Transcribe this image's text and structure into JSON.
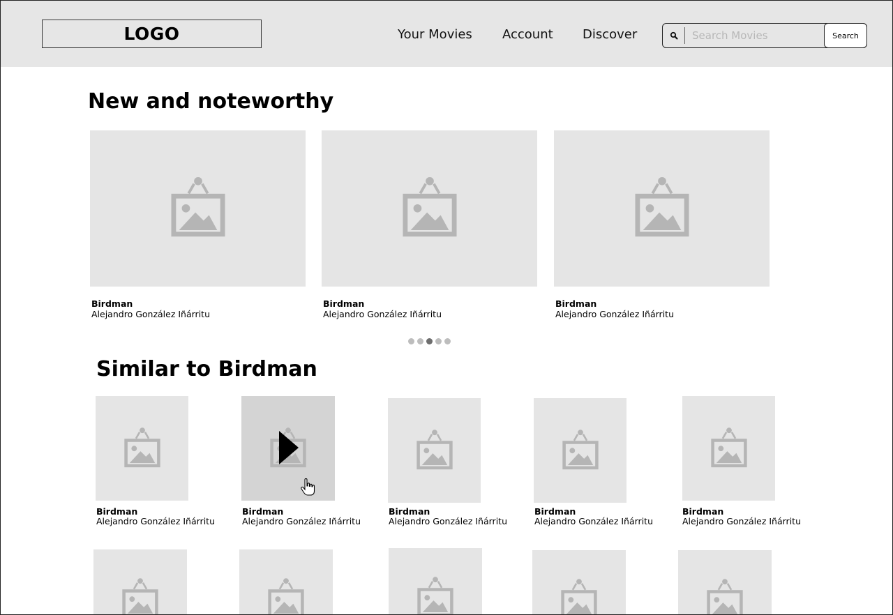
{
  "header": {
    "logo": "LOGO",
    "nav": [
      "Your Movies",
      "Account",
      "Discover"
    ],
    "search": {
      "placeholder": "Search Movies",
      "button": "Search",
      "icon": "search-icon"
    }
  },
  "featured": {
    "title": "New and noteworthy",
    "items": [
      {
        "title": "Birdman",
        "director": "Alejandro González Iñárritu"
      },
      {
        "title": "Birdman",
        "director": "Alejandro González Iñárritu"
      },
      {
        "title": "Birdman",
        "director": "Alejandro González Iñárritu"
      }
    ],
    "pagination": {
      "count": 5,
      "active": 3
    }
  },
  "similar": {
    "title": "Similar to Birdman",
    "items": [
      {
        "title": "Birdman",
        "director": "Alejandro González Iñárritu"
      },
      {
        "title": "Birdman",
        "director": "Alejandro González Iñárritu"
      },
      {
        "title": "Birdman",
        "director": "Alejandro González Iñárritu"
      },
      {
        "title": "Birdman",
        "director": "Alejandro González Iñárritu"
      },
      {
        "title": "Birdman",
        "director": "Alejandro González Iñárritu"
      }
    ]
  },
  "colors": {
    "header_bg": "#e6e6e6",
    "placeholder_bg": "#e5e5e5",
    "hover_bg": "#d4d4d4",
    "icon": "#b5b5b5"
  }
}
